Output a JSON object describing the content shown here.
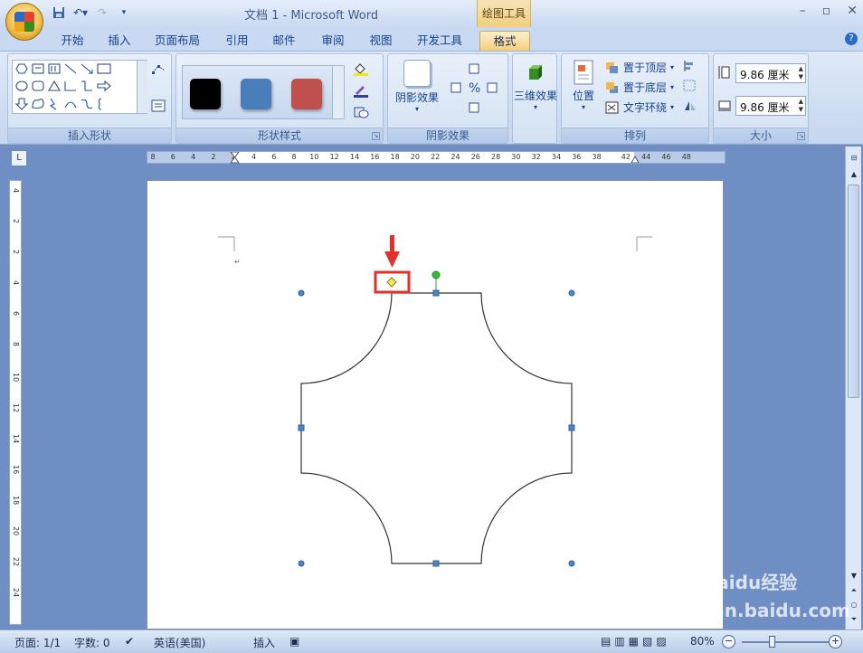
{
  "window": {
    "title": "文档 1 - Microsoft Word",
    "context_tab_title": "绘图工具"
  },
  "tabs": [
    {
      "label": "开始",
      "active": false
    },
    {
      "label": "插入",
      "active": false
    },
    {
      "label": "页面布局",
      "active": false
    },
    {
      "label": "引用",
      "active": false
    },
    {
      "label": "邮件",
      "active": false
    },
    {
      "label": "审阅",
      "active": false
    },
    {
      "label": "视图",
      "active": false
    },
    {
      "label": "开发工具",
      "active": false
    },
    {
      "label": "格式",
      "active": true
    }
  ],
  "ribbon": {
    "insert_shapes": {
      "label": "插入形状"
    },
    "shape_styles": {
      "label": "形状样式",
      "swatches": [
        "#000000",
        "#4a7ebb",
        "#c0504d"
      ]
    },
    "shadow_effects": {
      "label": "阴影效果",
      "button": "阴影效果"
    },
    "three_d": {
      "button": "三维效果"
    },
    "arrange": {
      "label": "排列",
      "position": "位置",
      "bring_front": "置于顶层",
      "send_back": "置于底层",
      "text_wrap": "文字环绕"
    },
    "size": {
      "label": "大小",
      "height": "9.86 厘米",
      "width": "9.86 厘米"
    }
  },
  "ruler": {
    "horizontal_ticks": [
      "8",
      "6",
      "4",
      "2",
      "2",
      "4",
      "6",
      "8",
      "10",
      "12",
      "14",
      "16",
      "18",
      "20",
      "22",
      "24",
      "26",
      "28",
      "30",
      "32",
      "34",
      "36",
      "38",
      "42",
      "44",
      "46",
      "48"
    ],
    "vertical_ticks": [
      "4",
      "2",
      "2",
      "4",
      "6",
      "8",
      "10",
      "12",
      "14",
      "16",
      "18",
      "20",
      "22",
      "24"
    ]
  },
  "status": {
    "page": "页面: 1/1",
    "words": "字数: 0",
    "language": "英语(美国)",
    "mode": "插入",
    "zoom": "80%"
  },
  "watermark": "Baidu经验 jingyan.baidu.com"
}
